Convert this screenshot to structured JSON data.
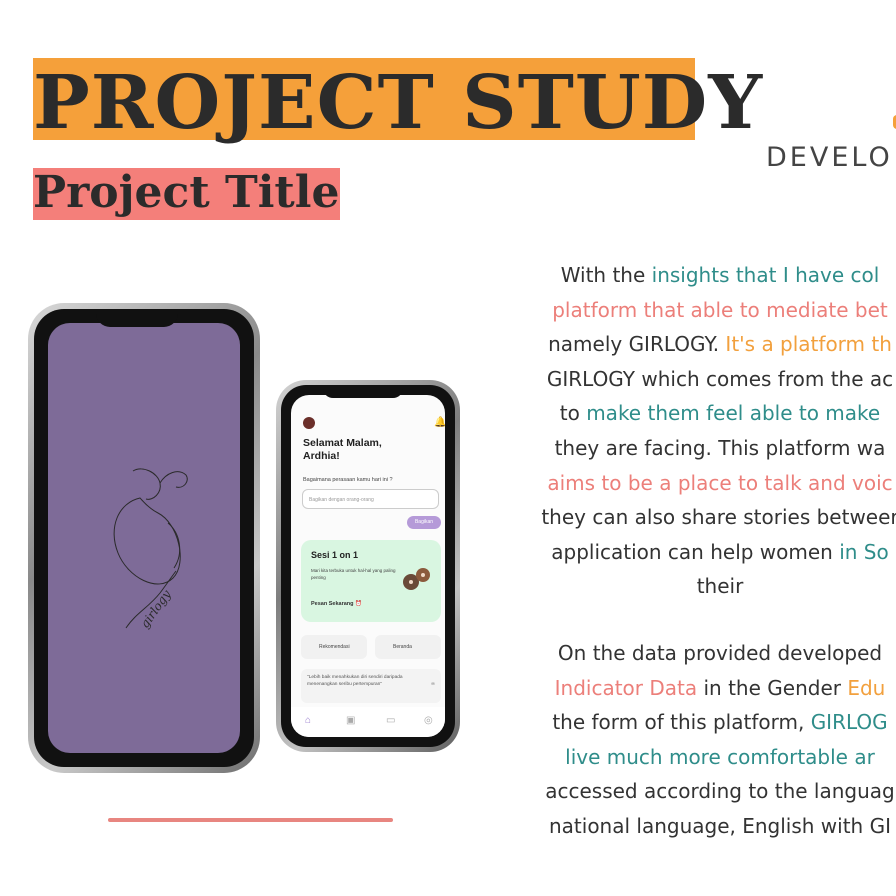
{
  "header": {
    "title": "PROJECT STUDY",
    "subtitle": "Project Title",
    "dev_label": "DEVELO"
  },
  "colors": {
    "accent_orange": "#f5a03a",
    "accent_pink": "#f47f7a",
    "teal": "#2f8d8a",
    "phone_screen_purple": "#7e6b98"
  },
  "paragraph1": [
    [
      {
        "t": "With the ",
        "c": ""
      },
      {
        "t": "insights that I have col",
        "c": "teal"
      }
    ],
    [
      {
        "t": "platform that able to mediate bet",
        "c": "pink"
      }
    ],
    [
      {
        "t": "namely GIRLOGY. ",
        "c": ""
      },
      {
        "t": "It's a platform th",
        "c": "orange"
      }
    ],
    [
      {
        "t": "GIRLOGY which comes from the ac",
        "c": ""
      }
    ],
    [
      {
        "t": "to ",
        "c": ""
      },
      {
        "t": "make them feel able to make",
        "c": "teal"
      }
    ],
    [
      {
        "t": "they are facing. This platform wa",
        "c": ""
      }
    ],
    [
      {
        "t": "aims to be a place to talk and voic",
        "c": "pink"
      }
    ],
    [
      {
        "t": "they can also share stories betweer",
        "c": ""
      }
    ],
    [
      {
        "t": "application can help women ",
        "c": ""
      },
      {
        "t": "in So",
        "c": "teal"
      }
    ],
    [
      {
        "t": "their",
        "c": ""
      }
    ]
  ],
  "paragraph2": [
    [
      {
        "t": "On the data provided developed",
        "c": ""
      }
    ],
    [
      {
        "t": "Indicator Data",
        "c": "pink"
      },
      {
        "t": " in the Gender ",
        "c": ""
      },
      {
        "t": "Edu",
        "c": "orange"
      }
    ],
    [
      {
        "t": "the form of this platform, ",
        "c": ""
      },
      {
        "t": "GIRLOG",
        "c": "teal"
      }
    ],
    [
      {
        "t": "live much more comfortable ar",
        "c": "teal"
      }
    ],
    [
      {
        "t": "accessed according to the languag",
        "c": ""
      }
    ],
    [
      {
        "t": "national language, English with GI",
        "c": ""
      }
    ]
  ],
  "app": {
    "greeting": "Selamat Malam, Ardhia!",
    "greeting_line1": "Selamat Malam,",
    "greeting_line2": "Ardhia!",
    "question": "Bagaimana perasaan kamu hari ini ?",
    "input_placeholder": "Bagikan dengan orang-orang",
    "share_button": "Bagikan",
    "card_title": "Sesi 1 on 1",
    "card_desc": "Mari kita terbuka untuk hal-hal yang paling penting",
    "card_link": "Pesan Sekarang ⏰",
    "chip1": "Rekomendasi",
    "chip2": "Beranda",
    "quote": "\"Lebih baik menahkukan diri sendiri daripada menenangkan seribu pertempuran\"",
    "nav": [
      "home-icon",
      "book-icon",
      "chat-icon",
      "profile-icon"
    ]
  }
}
